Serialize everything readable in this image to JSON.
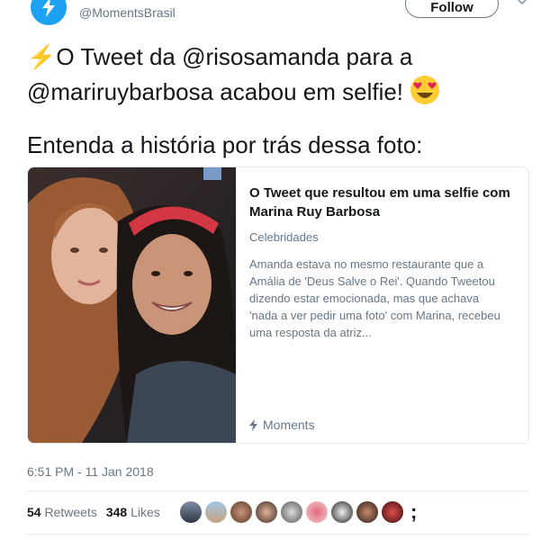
{
  "header": {
    "handle": "@MomentsBrasil",
    "follow_label": "Follow"
  },
  "tweet": {
    "line1_emoji": "⚡",
    "line1": "O Tweet da @risosamanda para a",
    "line2": "@mariruybarbosa acabou em selfie!",
    "line2_emoji": "😍",
    "line3": "Entenda a história por trás dessa foto:"
  },
  "card": {
    "title": "O Tweet que resultou em uma selfie com Marina Ruy Barbosa",
    "category": "Celebridades",
    "description": "Amanda estava no mesmo restaurante que a Amália de 'Deus Salve o Rei'. Quando Tweetou dizendo estar emocionada, mas que achava 'nada a ver pedir uma foto' com Marina, recebeu uma resposta da atriz...",
    "footer_label": "Moments",
    "footer_icon": "lightning-icon"
  },
  "meta": {
    "timestamp": "6:51 PM - 11 Jan 2018",
    "retweets_count": "54",
    "retweets_label": "Retweets",
    "likes_count": "348",
    "likes_label": "Likes",
    "more_glyph": ";"
  },
  "colors": {
    "brand": "#1da1f2",
    "muted": "#657786",
    "border": "#e1e8ed"
  }
}
